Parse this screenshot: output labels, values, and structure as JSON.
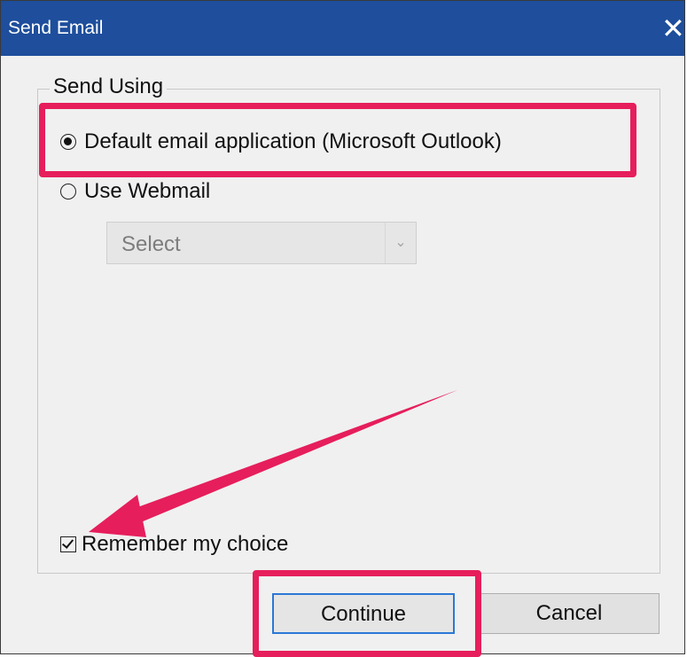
{
  "window": {
    "title": "Send Email",
    "close_glyph": "✕"
  },
  "send_using": {
    "legend": "Send Using",
    "options": [
      {
        "label": "Default email application (Microsoft Outlook)",
        "selected": true
      },
      {
        "label": "Use Webmail",
        "selected": false
      }
    ],
    "webmail_select": {
      "value": "Select",
      "enabled": false,
      "arrow_icon": "chevron-down-icon"
    }
  },
  "remember_choice": {
    "label": "Remember my choice",
    "checked": true
  },
  "buttons": {
    "continue_label": "Continue",
    "cancel_label": "Cancel"
  },
  "annotations": {
    "highlight_color": "#e61e5c",
    "highlights": [
      "default-email-option",
      "continue-button"
    ],
    "arrow_points_to": "remember-choice-checkbox"
  },
  "colors": {
    "titlebar": "#1e4e9c",
    "dialog_bg": "#f0f0f0",
    "focus_border": "#2b78d6"
  }
}
